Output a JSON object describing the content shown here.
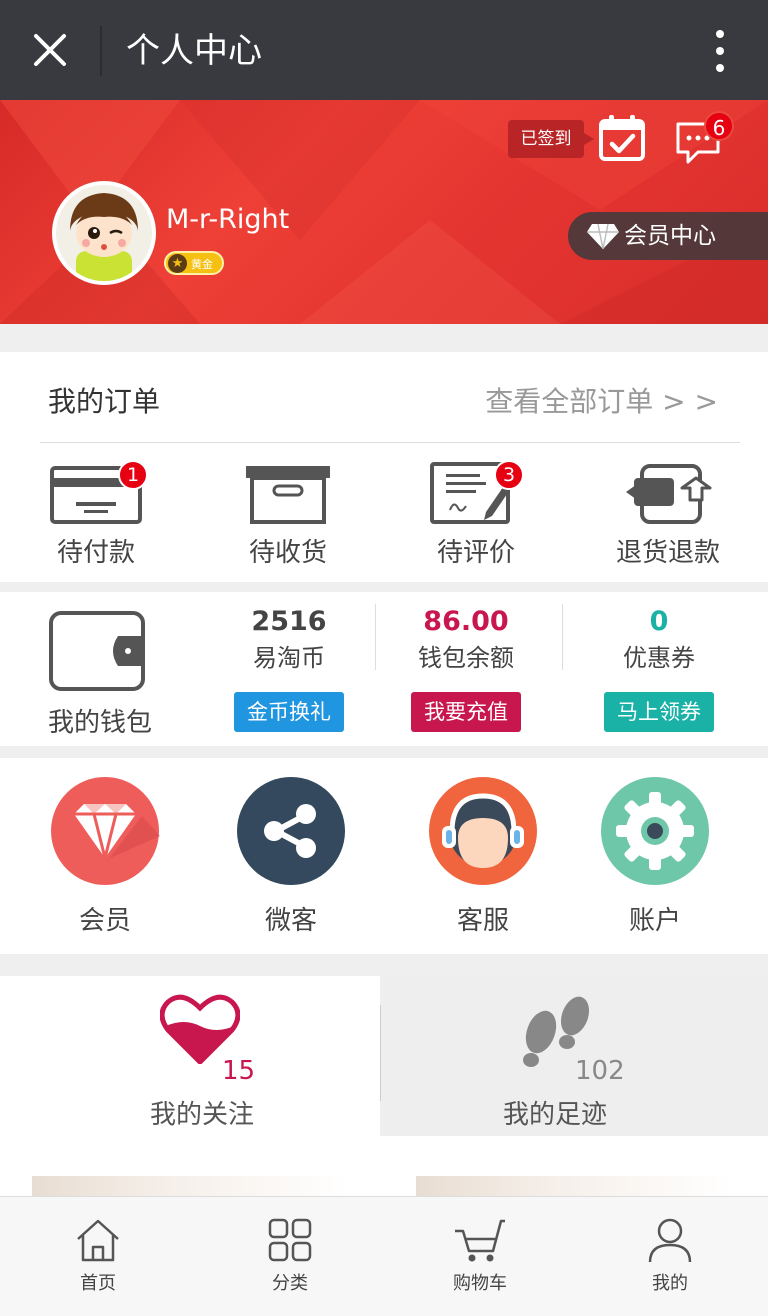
{
  "titlebar": {
    "title": "个人中心",
    "close_icon": "close-icon",
    "more_icon": "more-vertical-icon"
  },
  "profile": {
    "username": "M-r-Right",
    "level": "黄金",
    "signed_label": "已签到",
    "message_count": "6",
    "member_center_label": "会员中心"
  },
  "orders": {
    "title": "我的订单",
    "view_all": "查看全部订单 > >",
    "items": [
      {
        "label": "待付款",
        "icon": "payment-card-icon",
        "badge": "1"
      },
      {
        "label": "待收货",
        "icon": "package-box-icon",
        "badge": ""
      },
      {
        "label": "待评价",
        "icon": "review-pen-icon",
        "badge": "3"
      },
      {
        "label": "退货退款",
        "icon": "return-refund-icon",
        "badge": ""
      }
    ]
  },
  "wallet": {
    "label": "我的钱包",
    "stats": [
      {
        "value": "2516",
        "label": "易淘币",
        "button": "金币换礼",
        "color": "#444444",
        "button_color": "#2196e0"
      },
      {
        "value": "86.00",
        "label": "钱包余额",
        "button": "我要充值",
        "color": "#c8174f",
        "button_color": "#c8174f"
      },
      {
        "value": "0",
        "label": "优惠券",
        "button": "马上领券",
        "color": "#1ab1a6",
        "button_color": "#1ab1a6"
      }
    ]
  },
  "services": [
    {
      "label": "会员",
      "icon": "diamond-icon"
    },
    {
      "label": "微客",
      "icon": "share-icon"
    },
    {
      "label": "客服",
      "icon": "customer-service-icon"
    },
    {
      "label": "账户",
      "icon": "settings-gear-icon"
    }
  ],
  "follow": {
    "count": "15",
    "label": "我的关注"
  },
  "footprint": {
    "count": "102",
    "label": "我的足迹"
  },
  "bottom_nav": [
    {
      "label": "首页",
      "icon": "home-icon"
    },
    {
      "label": "分类",
      "icon": "category-grid-icon"
    },
    {
      "label": "购物车",
      "icon": "cart-icon"
    },
    {
      "label": "我的",
      "icon": "user-icon"
    }
  ],
  "colors": {
    "titlebar": "#393a3f",
    "banner": "#e53531",
    "badge": "#e60012"
  }
}
